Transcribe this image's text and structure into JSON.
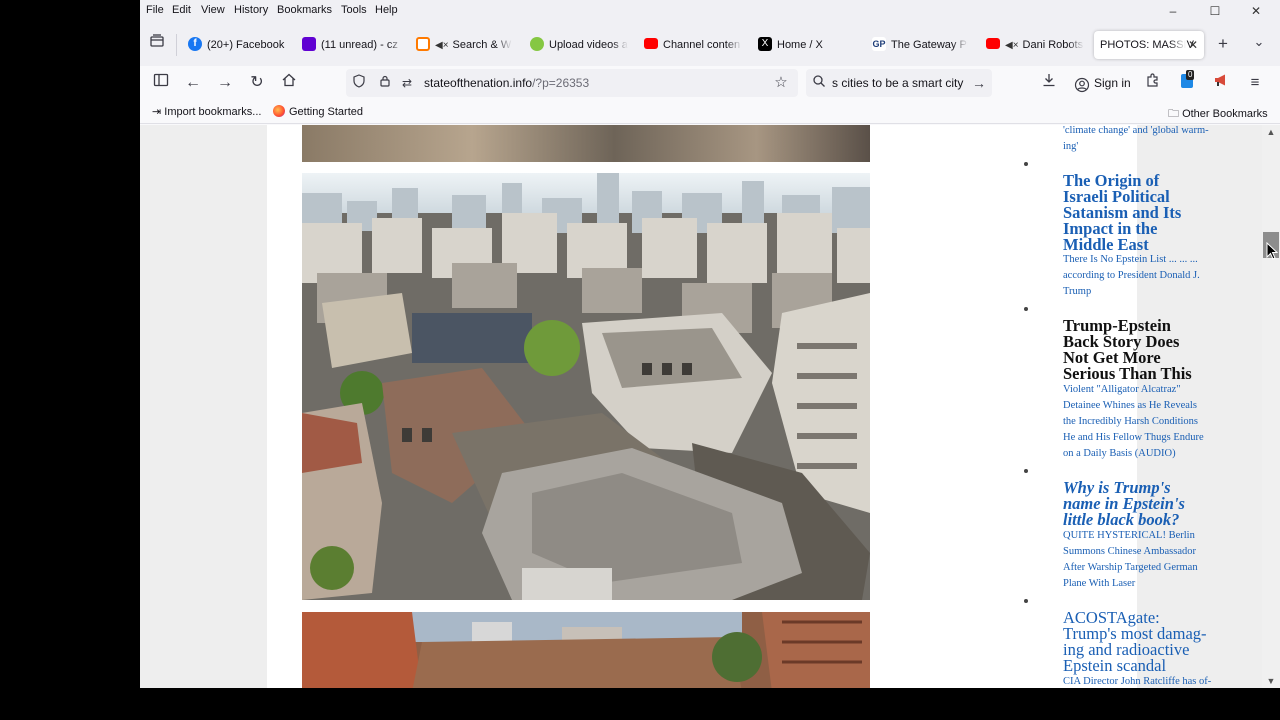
{
  "menubar": {
    "items": [
      "File",
      "Edit",
      "View",
      "History",
      "Bookmarks",
      "Tools",
      "Help"
    ],
    "minimize": "–",
    "maximize": "☐",
    "close": "✕"
  },
  "tabs": [
    {
      "label": "(20+) Facebook",
      "icon": "facebook-icon",
      "color": "#1877f2"
    },
    {
      "label": "(11 unread) - cz",
      "icon": "yahoo-mail-icon",
      "color": "#6001d2"
    },
    {
      "label": "Search & W",
      "icon": "search-app-icon",
      "color": "#ff7a00",
      "muted": true
    },
    {
      "label": "Upload videos a",
      "icon": "rumble-icon",
      "color": "#85c742"
    },
    {
      "label": "Channel conten",
      "icon": "youtube-icon",
      "color": "#ff0000"
    },
    {
      "label": "Home / X",
      "icon": "x-icon",
      "color": "#000000"
    },
    {
      "label": "The Gateway Pu",
      "icon": "gateway-pundit-icon",
      "color": "#1d3c78"
    },
    {
      "label": "Dani Robots",
      "icon": "youtube-icon",
      "color": "#ff0000",
      "muted": true
    },
    {
      "label": "PHOTOS: MASSIV",
      "active": true
    }
  ],
  "tabbar": {
    "new_tab": "+",
    "list_all": "⌄",
    "close_tab": "✕"
  },
  "navbar": {
    "url_host": "stateofthenation.info",
    "url_path": "/?p=26353",
    "search_query": "s cities to be a smart city",
    "search_go": "→",
    "signin_label": "Sign in",
    "badge": "0"
  },
  "bookmarks": {
    "import_label": "Import bookmarks...",
    "getting_started": "Getting Started",
    "other": "Other Bookmarks"
  },
  "sidebar": {
    "top_snippet": [
      "'climate change' and 'global warm-",
      "ing'"
    ],
    "entries": [
      {
        "headline": [
          "The Origin of",
          "Israeli Political",
          "Satanism and Its",
          "Impact in the",
          "Middle East"
        ],
        "style": "bold-blue",
        "sub": [
          "There Is No Epstein List ... ... ...",
          "according to President Donald J.",
          "Trump"
        ]
      },
      {
        "headline": [
          "Trump-Epstein",
          "Back Story Does",
          "Not Get More",
          "Serious Than This"
        ],
        "style": "bold-dark",
        "sub": [
          "Violent \"Alligator Alcatraz\"",
          "Detainee Whines as He Reveals",
          "the Incredibly Harsh Conditions",
          "He and His Fellow Thugs Endure",
          "on a Daily Basis (AUDIO)"
        ]
      },
      {
        "headline": [
          "Why is Trump's",
          "name in Epstein's",
          "little black book?"
        ],
        "style": "bold-italic-blue",
        "sub": [
          "QUITE HYSTERICAL! Berlin",
          "Summons Chinese Ambassador",
          "After Warship Targeted German",
          "Plane With Laser"
        ]
      },
      {
        "headline": [
          "ACOSTAgate:",
          "Trump's most damag-",
          "ing and radioactive",
          "Epstein scandal"
        ],
        "style": "normal-blue",
        "sub": [
          "CIA Director John Ratcliffe has of-"
        ]
      }
    ]
  },
  "colors": {
    "link": "#1a5fb4",
    "page_bg": "#eeeeee",
    "chrome_bg": "#f0f0f4"
  }
}
